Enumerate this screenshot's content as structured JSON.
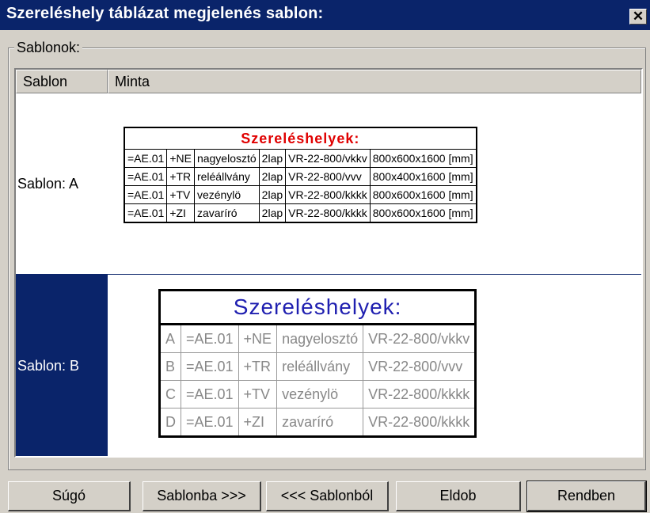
{
  "dialog": {
    "title": "Szereléshely táblázat megjelenés sablon:",
    "close_glyph": "✕",
    "group_label": "Sablonok:"
  },
  "list": {
    "columns": [
      "Sablon",
      "Minta"
    ],
    "rows": [
      {
        "label": "Sablon: A",
        "table_title": "Szereléshelyek:",
        "cells": [
          [
            "=AE.01",
            "+NE",
            "nagyelosztó",
            "2lap",
            "VR-22-800/vkkv",
            "800x600x1600 [mm]"
          ],
          [
            "=AE.01",
            "+TR",
            "reléállvány",
            "2lap",
            "VR-22-800/vvv",
            "800x400x1600 [mm]"
          ],
          [
            "=AE.01",
            "+TV",
            "vezénylö",
            "2lap",
            "VR-22-800/kkkk",
            "800x600x1600 [mm]"
          ],
          [
            "=AE.01",
            "+ZI",
            "zavaríró",
            "2lap",
            "VR-22-800/kkkk",
            "800x600x1600 [mm]"
          ]
        ]
      },
      {
        "label": "Sablon: B",
        "table_title": "Szereléshelyek:",
        "cells": [
          [
            "A",
            "=AE.01",
            "+NE",
            "nagyelosztó",
            "VR-22-800/vkkv"
          ],
          [
            "B",
            "=AE.01",
            "+TR",
            "reléállvány",
            "VR-22-800/vvv"
          ],
          [
            "C",
            "=AE.01",
            "+TV",
            "vezénylö",
            "VR-22-800/kkkk"
          ],
          [
            "D",
            "=AE.01",
            "+ZI",
            "zavaríró",
            "VR-22-800/kkkk"
          ]
        ]
      }
    ]
  },
  "buttons": {
    "help": "Súgó",
    "to_template": "Sablonba >>>",
    "from_template": "<<< Sablonból",
    "discard": "Eldob",
    "ok": "Rendben"
  },
  "colors": {
    "title_bar": "#0a246a",
    "selection": "#0a246a",
    "template_a_title": "#e00000",
    "template_b_title": "#1f1fb0"
  }
}
